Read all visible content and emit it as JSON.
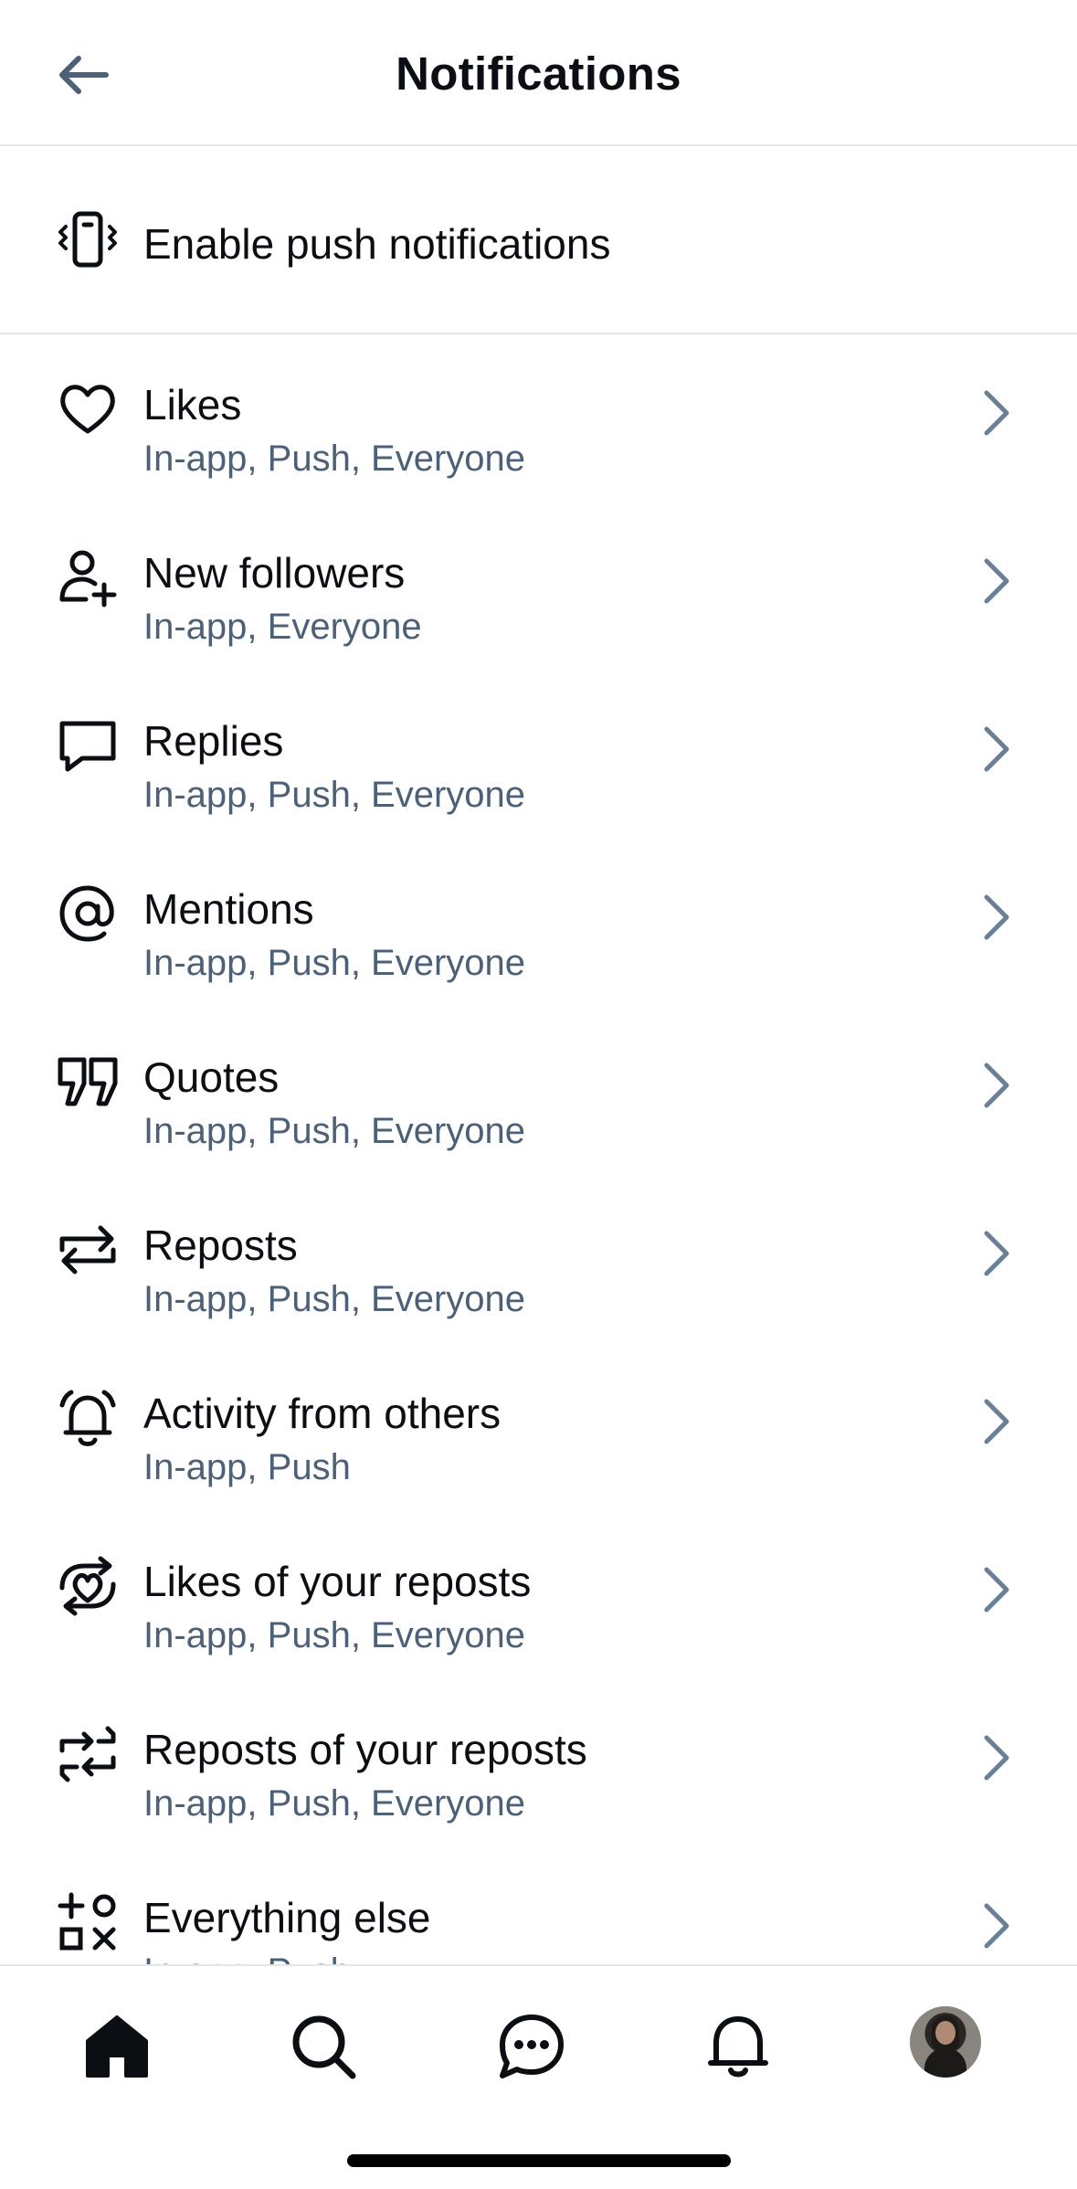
{
  "header": {
    "title": "Notifications",
    "back_icon": "arrow-left-icon"
  },
  "push": {
    "label": "Enable push notifications",
    "icon": "phone-vibrate-icon"
  },
  "rows": [
    {
      "title": "Likes",
      "subtitle": "In-app, Push, Everyone",
      "icon": "heart-icon"
    },
    {
      "title": "New followers",
      "subtitle": "In-app, Everyone",
      "icon": "person-plus-icon"
    },
    {
      "title": "Replies",
      "subtitle": "In-app, Push, Everyone",
      "icon": "speech-bubble-icon"
    },
    {
      "title": "Mentions",
      "subtitle": "In-app, Push, Everyone",
      "icon": "at-sign-icon"
    },
    {
      "title": "Quotes",
      "subtitle": "In-app, Push, Everyone",
      "icon": "quote-icon"
    },
    {
      "title": "Reposts",
      "subtitle": "In-app, Push, Everyone",
      "icon": "repost-icon"
    },
    {
      "title": "Activity from others",
      "subtitle": "In-app, Push",
      "icon": "bell-ringing-icon"
    },
    {
      "title": "Likes of your reposts",
      "subtitle": "In-app, Push, Everyone",
      "icon": "heart-repost-icon"
    },
    {
      "title": "Reposts of your reposts",
      "subtitle": "In-app, Push, Everyone",
      "icon": "repost-of-repost-icon"
    },
    {
      "title": "Everything else",
      "subtitle": "In-app, Push",
      "icon": "shapes-icon"
    }
  ],
  "tabs": [
    "home-icon",
    "search-icon",
    "chat-icon",
    "bell-icon",
    "avatar"
  ],
  "colors": {
    "text": "#0b0f14",
    "subtext": "#4c6178",
    "chevron": "#6b7f96",
    "divider": "#e3e7ec"
  }
}
